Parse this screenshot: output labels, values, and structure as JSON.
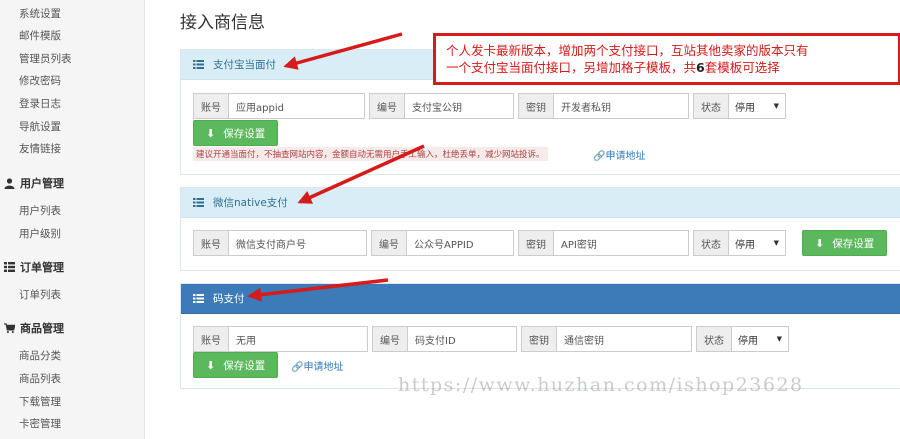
{
  "sidebar": {
    "top_items": [
      "系统设置",
      "邮件模版",
      "管理员列表",
      "修改密码",
      "登录日志",
      "导航设置",
      "友情链接"
    ],
    "groups": [
      {
        "title": "用户管理",
        "icon": "user-icon",
        "items": [
          "用户列表",
          "用户级别"
        ]
      },
      {
        "title": "订单管理",
        "icon": "list-icon",
        "items": [
          "订单列表"
        ]
      },
      {
        "title": "商品管理",
        "icon": "cart-icon",
        "items": [
          "商品分类",
          "商品列表",
          "下载管理",
          "卡密管理"
        ]
      }
    ]
  },
  "page_title": "接入商信息",
  "panels": [
    {
      "title": "支付宝当面付",
      "fields": {
        "account_label": "账号",
        "account_value": "应用appid",
        "number_label": "编号",
        "number_value": "支付宝公钥",
        "key_label": "密钥",
        "key_value": "开发者私钥",
        "status_label": "状态",
        "status_value": "停用"
      },
      "save_label": "保存设置",
      "note": "建议开通当面付，不抽查网站内容，金额自动无需用户手工输入，杜绝丢单，减少网站投诉。",
      "apply_link": "申请地址"
    },
    {
      "title": "微信native支付",
      "fields": {
        "account_label": "账号",
        "account_value": "微信支付商户号",
        "number_label": "编号",
        "number_value": "公众号APPID",
        "key_label": "密钥",
        "key_value": "API密钥",
        "status_label": "状态",
        "status_value": "停用"
      },
      "save_label": "保存设置"
    },
    {
      "title": "码支付",
      "fields": {
        "account_label": "账号",
        "account_value": "无用",
        "number_label": "编号",
        "number_value": "码支付ID",
        "key_label": "密钥",
        "key_value": "通信密钥",
        "status_label": "状态",
        "status_value": "停用"
      },
      "save_label": "保存设置",
      "apply_link": "申请地址"
    }
  ],
  "annotation": {
    "line1": "个人发卡最新版本，增加两个支付接口，互站其他卖家的版本只有",
    "line2a": "一个支付宝当面付接口，另增加格子模板，共",
    "glyph": "6",
    "line2b": "套模板可选择"
  },
  "watermark": "https://www.huzhan.com/ishop23628",
  "colors": {
    "panel_head": "#d9edf7",
    "panel_head_dark": "#3c7ab8",
    "save_button": "#5cb85c",
    "annotation_red": "#d71a1a"
  }
}
